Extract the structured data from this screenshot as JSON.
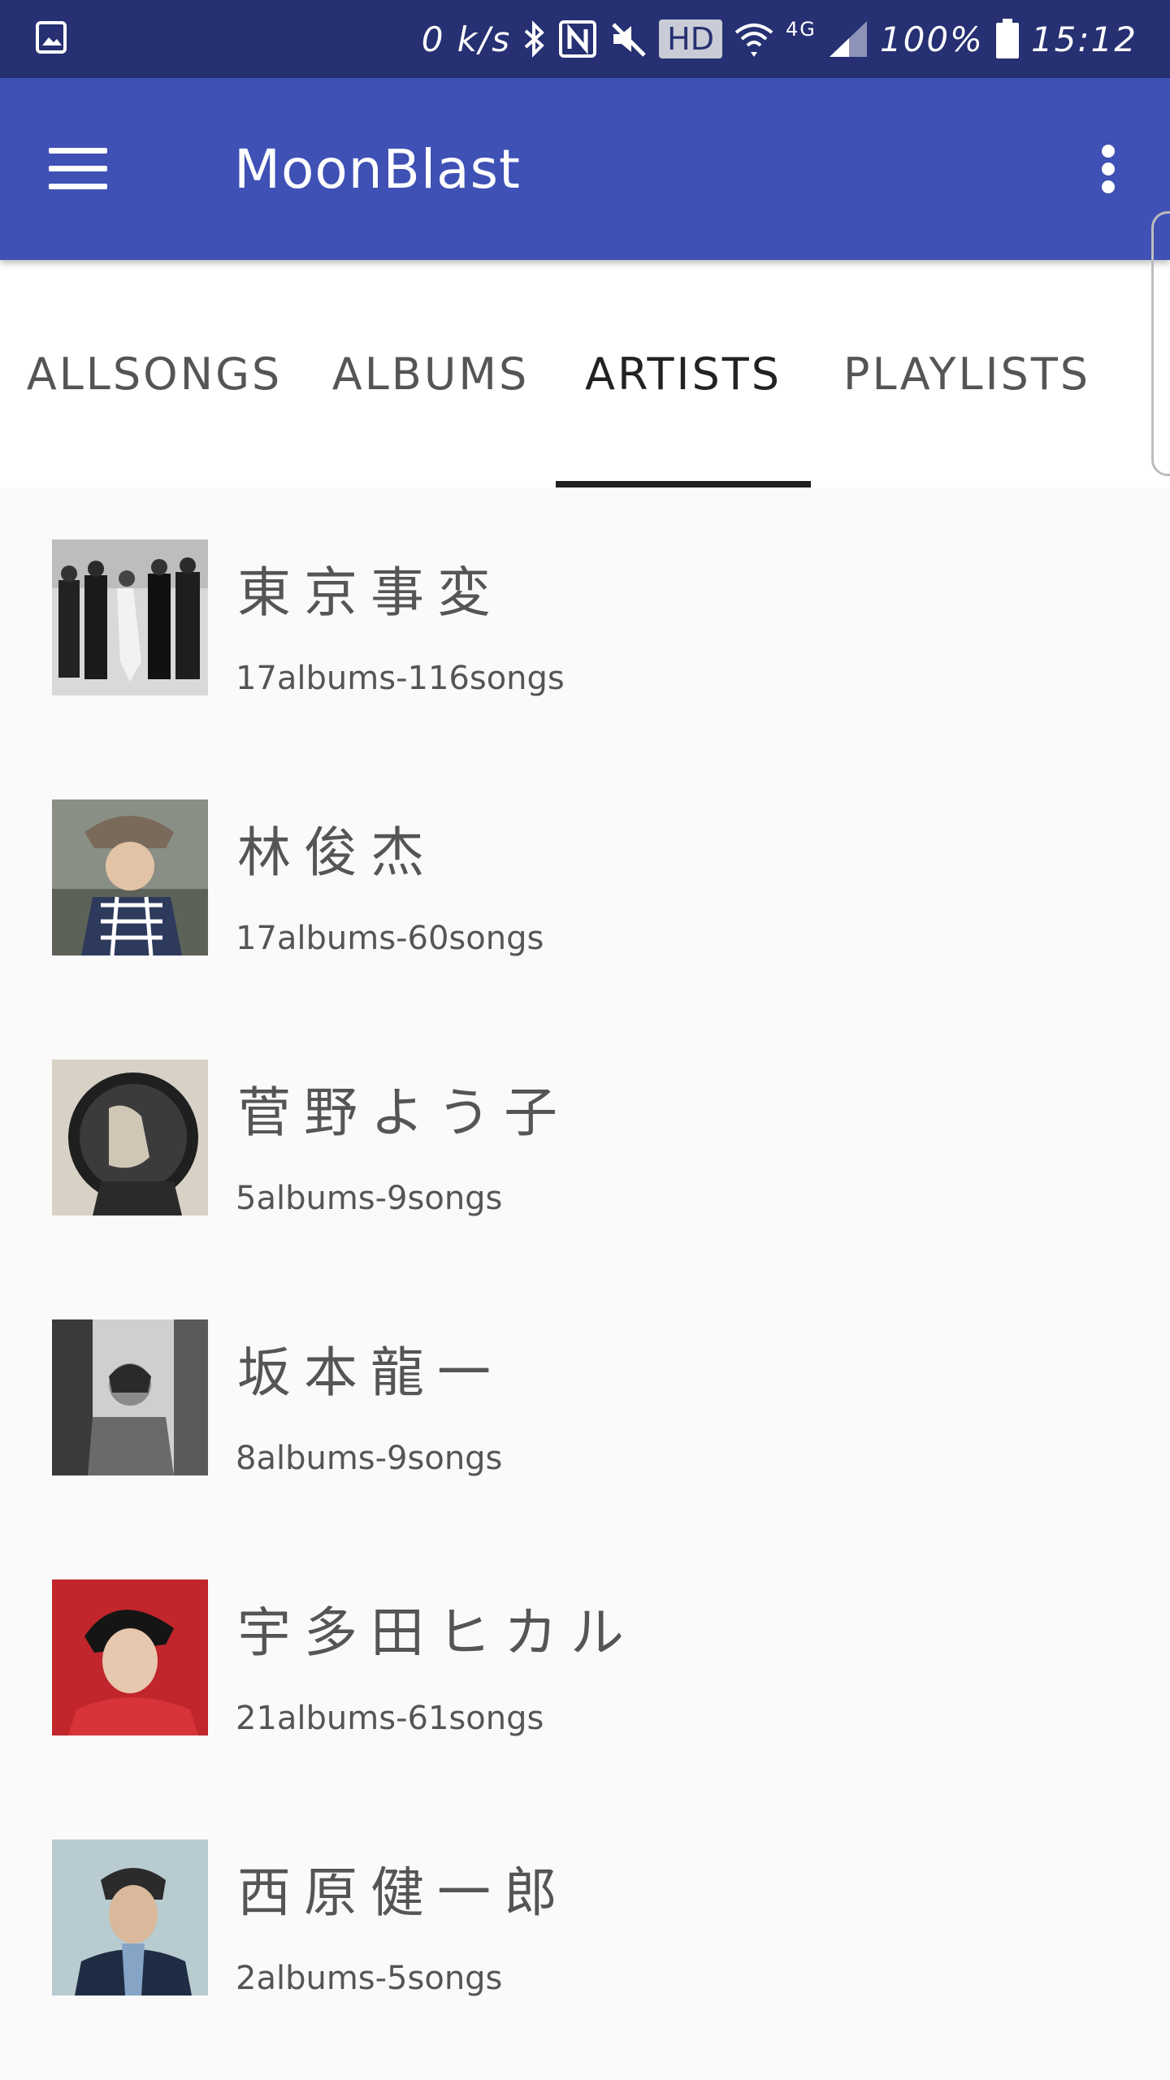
{
  "status_bar": {
    "net_speed": "0 k/s",
    "hd": "HD",
    "network": "4G",
    "battery": "100%",
    "time": "15:12"
  },
  "app_bar": {
    "title": "MoonBlast"
  },
  "tabs": [
    {
      "label": "ALLSONGS",
      "active": false
    },
    {
      "label": "ALBUMS",
      "active": false
    },
    {
      "label": "ARTISTS",
      "active": true
    },
    {
      "label": "PLAYLISTS",
      "active": false
    }
  ],
  "artists": [
    {
      "name": "東京事変",
      "meta": "17albums-116songs"
    },
    {
      "name": "林俊杰",
      "meta": "17albums-60songs"
    },
    {
      "name": "菅野よう子",
      "meta": "5albums-9songs"
    },
    {
      "name": "坂本龍一",
      "meta": "8albums-9songs"
    },
    {
      "name": "宇多田ヒカル",
      "meta": "21albums-61songs"
    },
    {
      "name": "西原健一郎",
      "meta": "2albums-5songs"
    }
  ],
  "colors": {
    "status_bar": "#263072",
    "app_bar": "#3f51b5",
    "tab_indicator": "#212121",
    "list_background": "#fafafa"
  },
  "icons": [
    "gallery-icon",
    "bluetooth-icon",
    "nfc-icon",
    "mute-icon",
    "wifi-icon",
    "signal-icon",
    "battery-icon",
    "menu-icon",
    "more-vert-icon"
  ]
}
